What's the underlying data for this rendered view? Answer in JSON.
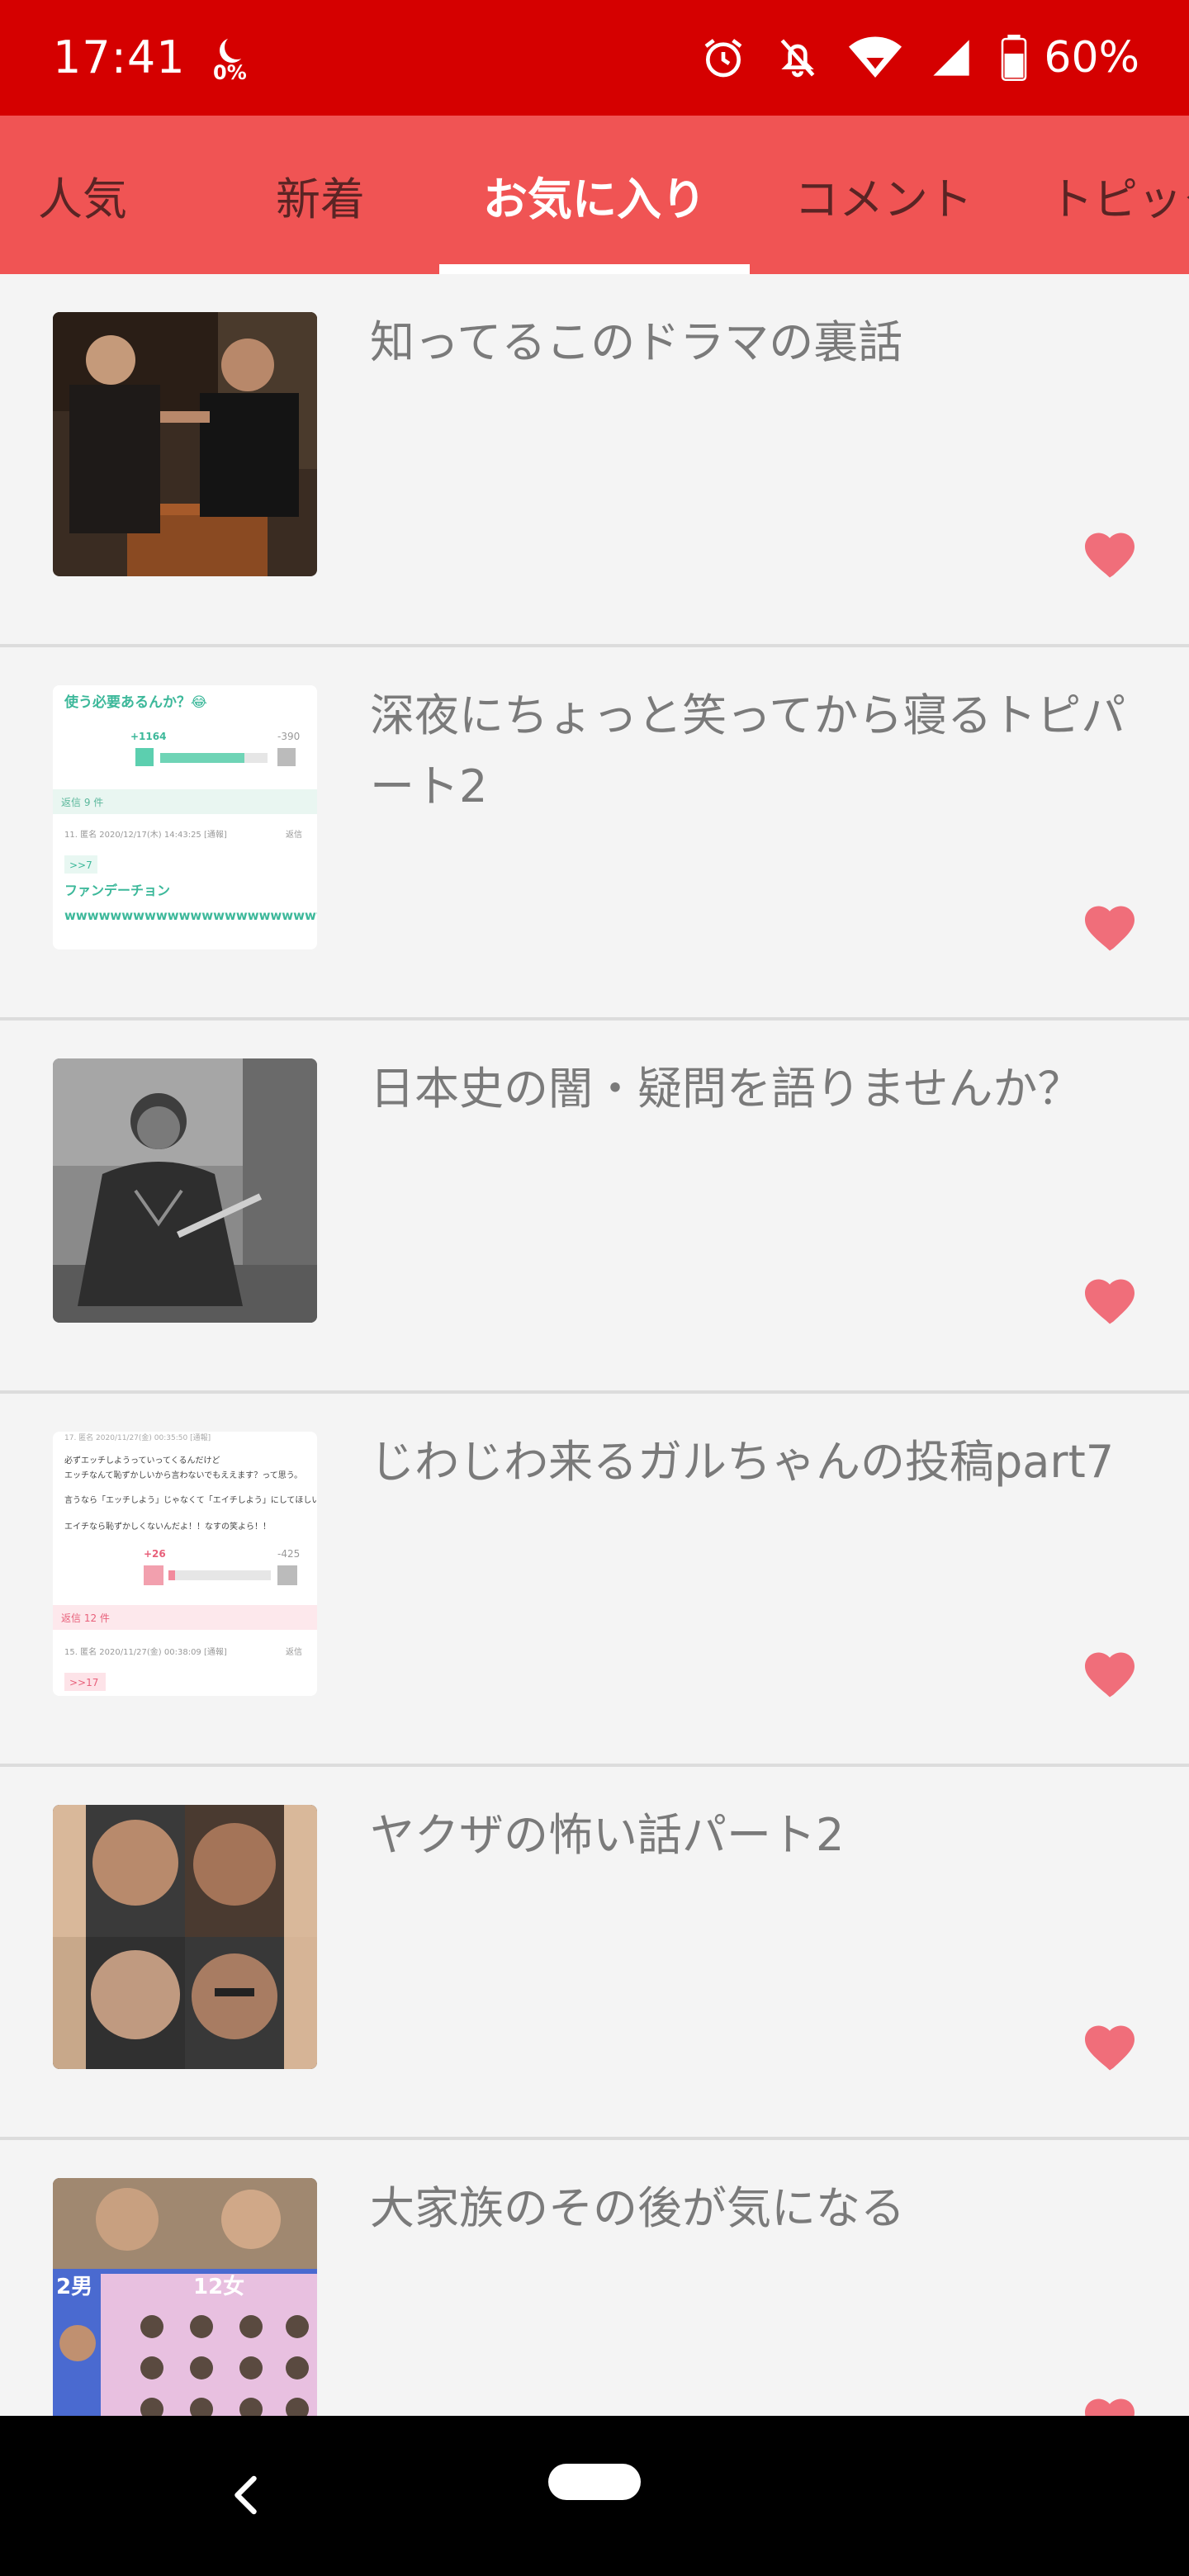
{
  "status_bar": {
    "time": "17:41",
    "data_usage": "0%",
    "battery": "60%",
    "icons": [
      "alarm-icon",
      "notifications-off-icon",
      "wifi-icon",
      "signal-icon",
      "battery-icon"
    ]
  },
  "tabs": [
    {
      "label": "人気",
      "active": false
    },
    {
      "label": "新着",
      "active": false
    },
    {
      "label": "お気に入り",
      "active": true
    },
    {
      "label": "コメント",
      "active": false
    },
    {
      "label": "トピック",
      "active": false
    }
  ],
  "favorites": [
    {
      "title": "知ってるこのドラマの裏話",
      "favorited": true
    },
    {
      "title": "深夜にちょっと笑ってから寝るトピパート2",
      "favorited": true
    },
    {
      "title": "日本史の闇・疑問を語りませんか？",
      "favorited": true
    },
    {
      "title": "じわじわ来るガルちゃんの投稿part7",
      "favorited": true
    },
    {
      "title": "ヤクザの怖い話パート2",
      "favorited": true
    },
    {
      "title": "大家族のその後が気になる",
      "favorited": true
    }
  ],
  "thumbnails": {
    "t2": {
      "plus": "+1164",
      "minus": "-390",
      "replies": "返信 9 件",
      "meta": "11. 匿名 2020/12/17(木) 14:43:25 [通報]",
      "reply_label": "返信",
      "anchor": ">>7",
      "heading": "ファンデーチョン",
      "body": "wwwwwwwwwwwwwwwwwwwwwww",
      "top_text": "使う必要あるんか？😂"
    },
    "t4": {
      "meta_top": "17. 匿名 2020/11/27(金) 00:35:50 [通報]",
      "lines": [
        "必ずエッチしようっていってくるんだけど",
        "エッチなんて恥ずかしいから言わないでもええます？って思う。",
        "言うなら「エッチしよう」じゃなくて「エイチしよう」にしてほしい。",
        "エイチなら恥ずかしくないんだよ！！なすの笑よら！！"
      ],
      "plus": "+26",
      "minus": "-425",
      "replies": "返信 12 件",
      "meta": "15. 匿名 2020/11/27(金) 00:38:09 [通報]",
      "reply_label": "返信",
      "anchor": ">>17"
    },
    "t6": {
      "left_label": "2男",
      "right_label": "12女"
    }
  },
  "colors": {
    "status_bar": "#d50000",
    "tab_bar": "#f05454",
    "heart": "#f06e7a",
    "title_text": "#7a7a7a"
  }
}
